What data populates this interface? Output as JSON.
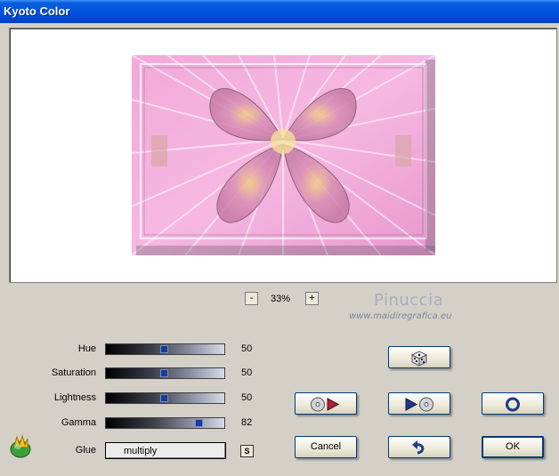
{
  "window": {
    "title": "Kyoto Color"
  },
  "zoom": {
    "minus_label": "-",
    "level": "33%",
    "plus_label": "+"
  },
  "branding": {
    "name": "Pinuccia",
    "url": "www.maidiregrafica.eu"
  },
  "controls": {
    "hue": {
      "label": "Hue",
      "value": "50",
      "fraction": 0.5
    },
    "saturation": {
      "label": "Saturation",
      "value": "50",
      "fraction": 0.5
    },
    "lightness": {
      "label": "Lightness",
      "value": "50",
      "fraction": 0.5
    },
    "gamma": {
      "label": "Gamma",
      "value": "82",
      "fraction": 0.82
    },
    "glue": {
      "label": "Glue",
      "value": "multiply",
      "s_button": "S"
    }
  },
  "buttons": {
    "cancel": "Cancel",
    "ok": "OK",
    "random_icon": "dice-icon",
    "play_forward_icon": "disc-play-icon",
    "play_back_icon": "play-disc-icon",
    "reset_icon": "ring-icon",
    "undo_icon": "undo-arrow-icon"
  }
}
